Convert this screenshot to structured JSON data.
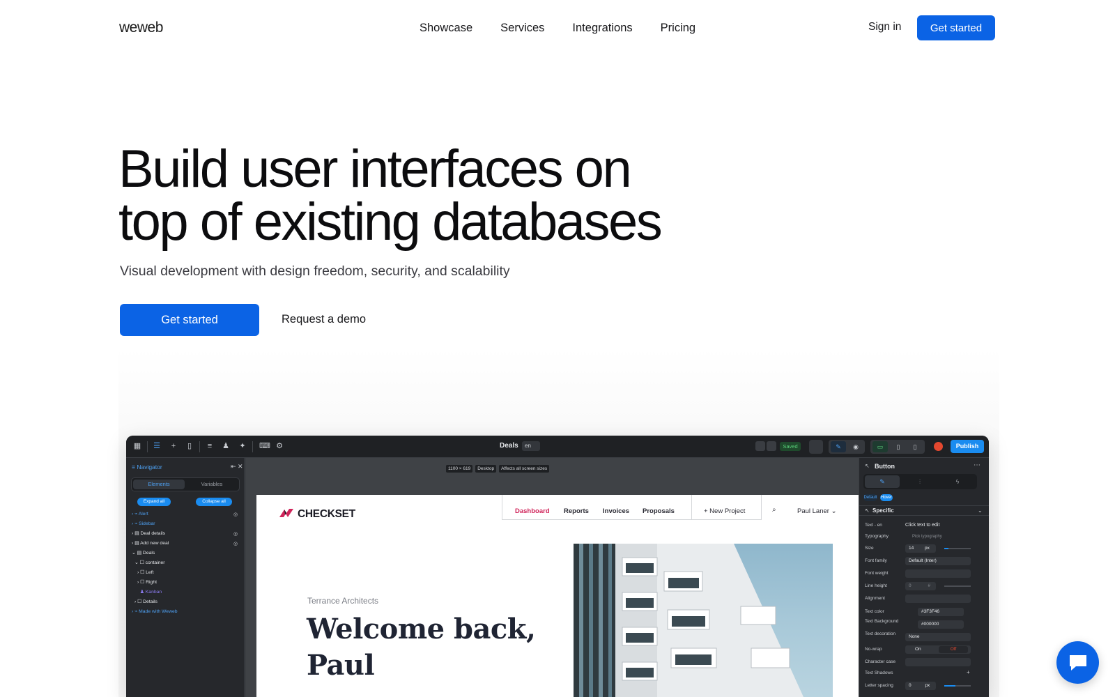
{
  "nav": {
    "logo": "weweb",
    "links": [
      "Showcase",
      "Services",
      "Integrations",
      "Pricing"
    ],
    "signin": "Sign in",
    "get_started": "Get started"
  },
  "hero": {
    "title_line1": "Build user interfaces on",
    "title_line2": "top of existing databases",
    "subtitle": "Visual development with design freedom, security, and scalability",
    "cta_primary": "Get started",
    "cta_secondary": "Request a demo"
  },
  "editor": {
    "document": "Deals",
    "lang": "en",
    "saved": "Saved",
    "publish": "Publish",
    "navigator": {
      "title": "Navigator",
      "tabs": [
        "Elements",
        "Variables"
      ],
      "expand_all": "Expand all",
      "collapse_all": "Collapse all",
      "items": [
        {
          "label": "Alert",
          "style": "blue"
        },
        {
          "label": "Sidebar",
          "style": "blue"
        },
        {
          "label": "Deal details",
          "style": "normal"
        },
        {
          "label": "Add new deal",
          "style": "normal"
        },
        {
          "label": "Deals",
          "style": "normal"
        },
        {
          "label": "container",
          "style": "normal"
        },
        {
          "label": "Left",
          "style": "normal"
        },
        {
          "label": "Right",
          "style": "normal"
        },
        {
          "label": "Kanban",
          "style": "purple"
        },
        {
          "label": "Details",
          "style": "normal"
        },
        {
          "label": "Made with Weweb",
          "style": "blue"
        }
      ]
    },
    "canvas_tags": [
      "1100 × 619",
      "Desktop",
      "Affects all screen sizes"
    ],
    "site": {
      "logo": "CHECKSET",
      "nav": [
        "Dashboard",
        "Reports",
        "Invoices",
        "Proposals"
      ],
      "new_project": "+ New Project",
      "user": "Paul Laner",
      "company": "Terrance Architects",
      "welcome_line1": "Welcome back,",
      "welcome_line2": "Paul"
    },
    "panel": {
      "title": "Button",
      "mini_tabs": [
        "Default",
        "Hover"
      ],
      "section": "Specific",
      "rows": [
        {
          "label": "Text - en",
          "value": "Click text to edit"
        },
        {
          "label": "Typography",
          "value": "Pick typography"
        },
        {
          "label": "Size",
          "value": "14",
          "unit": "px"
        },
        {
          "label": "Font family",
          "value": "Default (Inter)"
        },
        {
          "label": "Font weight",
          "value": ""
        },
        {
          "label": "Line height",
          "value": "0",
          "unit": "#"
        },
        {
          "label": "Alignment",
          "value": ""
        },
        {
          "label": "Text color",
          "value": "#3F3F46"
        },
        {
          "label": "Text Background",
          "value": "#000000"
        },
        {
          "label": "Text decoration",
          "value": "None"
        },
        {
          "label": "No-wrap",
          "value": "On",
          "value2": "Off"
        },
        {
          "label": "Character case",
          "value": ""
        },
        {
          "label": "Text Shadows",
          "value": ""
        },
        {
          "label": "Letter spacing",
          "value": "0",
          "unit": "px"
        }
      ]
    }
  },
  "colors": {
    "brand_blue": "#0b63e5",
    "editor_blue": "#1a8cf0",
    "checkset_pink": "#d0245a"
  },
  "icons": [
    "chat-icon",
    "search-icon",
    "close-icon",
    "eye-off-icon",
    "grid-icon"
  ]
}
